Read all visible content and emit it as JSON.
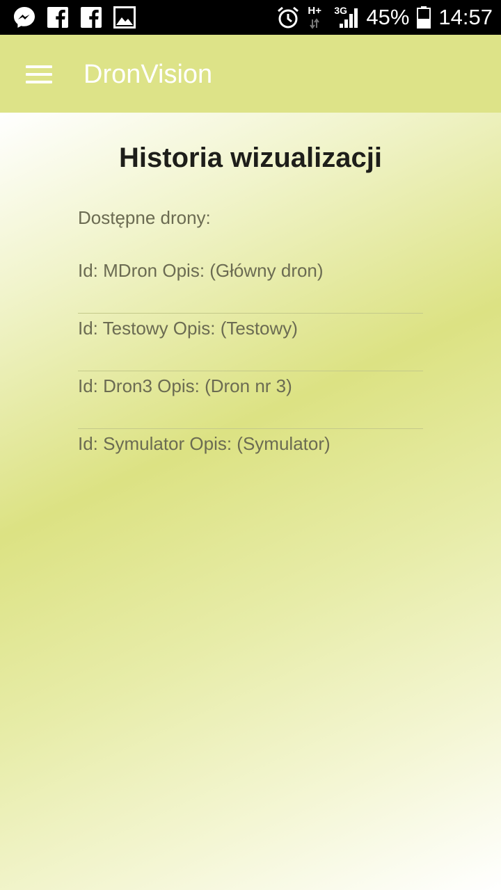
{
  "status_bar": {
    "icons_left": [
      "messenger-icon",
      "facebook-icon",
      "facebook-icon",
      "gallery-icon"
    ],
    "icons_right": [
      "alarm-icon",
      "network-h-plus-icon",
      "signal-3g-icon",
      "battery-icon"
    ],
    "network_type": "H+",
    "network_gen": "3G",
    "battery": "45%",
    "time": "14:57"
  },
  "app_bar": {
    "title": "DronVision",
    "menu_icon": "hamburger-menu-icon",
    "background": "#dde388"
  },
  "page": {
    "title": "Historia wizualizacji",
    "section_label": "Dostępne drony:",
    "drones": [
      {
        "label": "Id: MDron Opis: (Główny dron)"
      },
      {
        "label": "Id: Testowy Opis: (Testowy)"
      },
      {
        "label": "Id: Dron3 Opis: (Dron nr 3)"
      },
      {
        "label": "Id: Symulator Opis: (Symulator)"
      }
    ]
  }
}
